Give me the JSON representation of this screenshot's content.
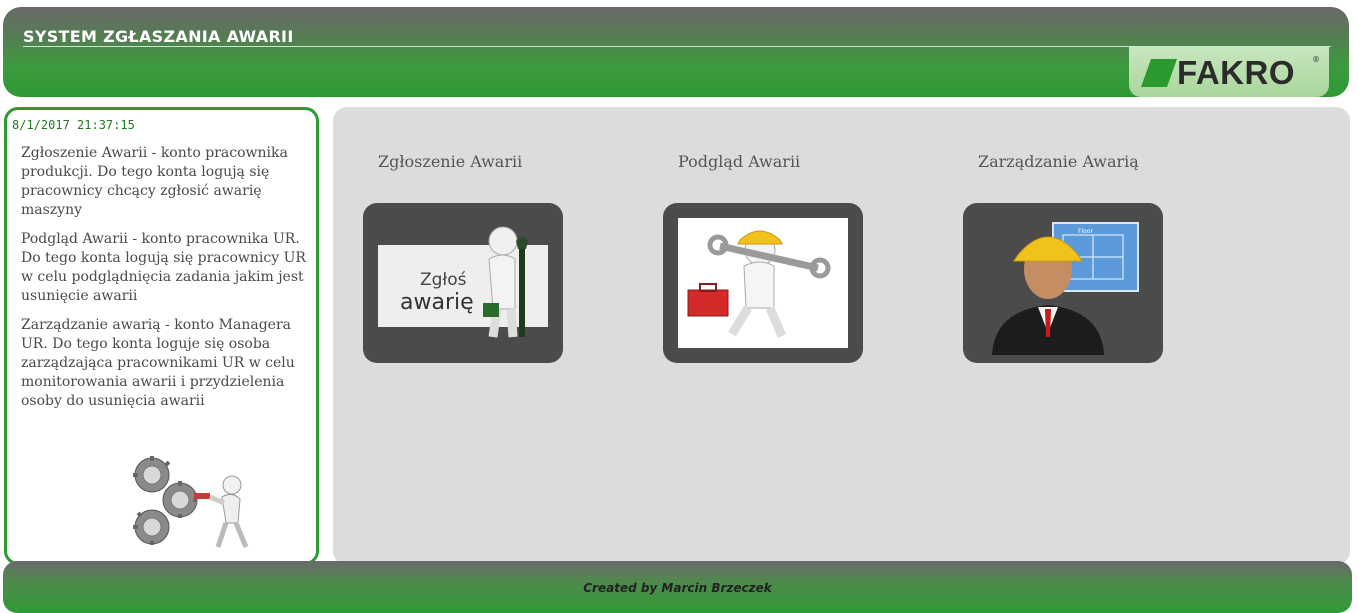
{
  "header": {
    "title": "SYSTEM ZGŁASZANIA AWARII",
    "logo_text": "FAKRO",
    "logo_reg": "®"
  },
  "sidebar": {
    "datetime": "8/1/2017 21:37:15",
    "descriptions": [
      "Zgłoszenie Awarii - konto pracownika produkcji. Do tego konta logują się pracownicy chcący zgłosić awarię maszyny",
      "Podgląd Awarii - konto pracownika UR. Do tego konta logują się pracownicy UR w celu podglądnięcia zadania jakim jest usunięcie awarii",
      "Zarządzanie awarią - konto Managera UR. Do tego konta loguje się osoba zarządzająca pracownikami UR w celu monitorowania awarii i przydzielenia osoby do usunięcia awarii"
    ],
    "image_icon": "gears-figure-icon"
  },
  "main": {
    "tiles": [
      {
        "title": "Zgłoszenie Awarii",
        "image_icon": "report-failure-figure-icon",
        "image_text_1": "Zgłoś",
        "image_text_2": "awarię"
      },
      {
        "title": "Podgląd Awarii",
        "image_icon": "repairman-toolbox-icon"
      },
      {
        "title": "Zarządzanie Awarią",
        "image_icon": "manager-blueprint-icon",
        "image_text_1": "Floor"
      }
    ]
  },
  "footer": {
    "text": "Created by Marcin Brzeczek"
  },
  "colors": {
    "brand_green": "#2e9a33",
    "panel_gray": "#dcdcdc",
    "tile_dark": "#4b4b4b"
  }
}
